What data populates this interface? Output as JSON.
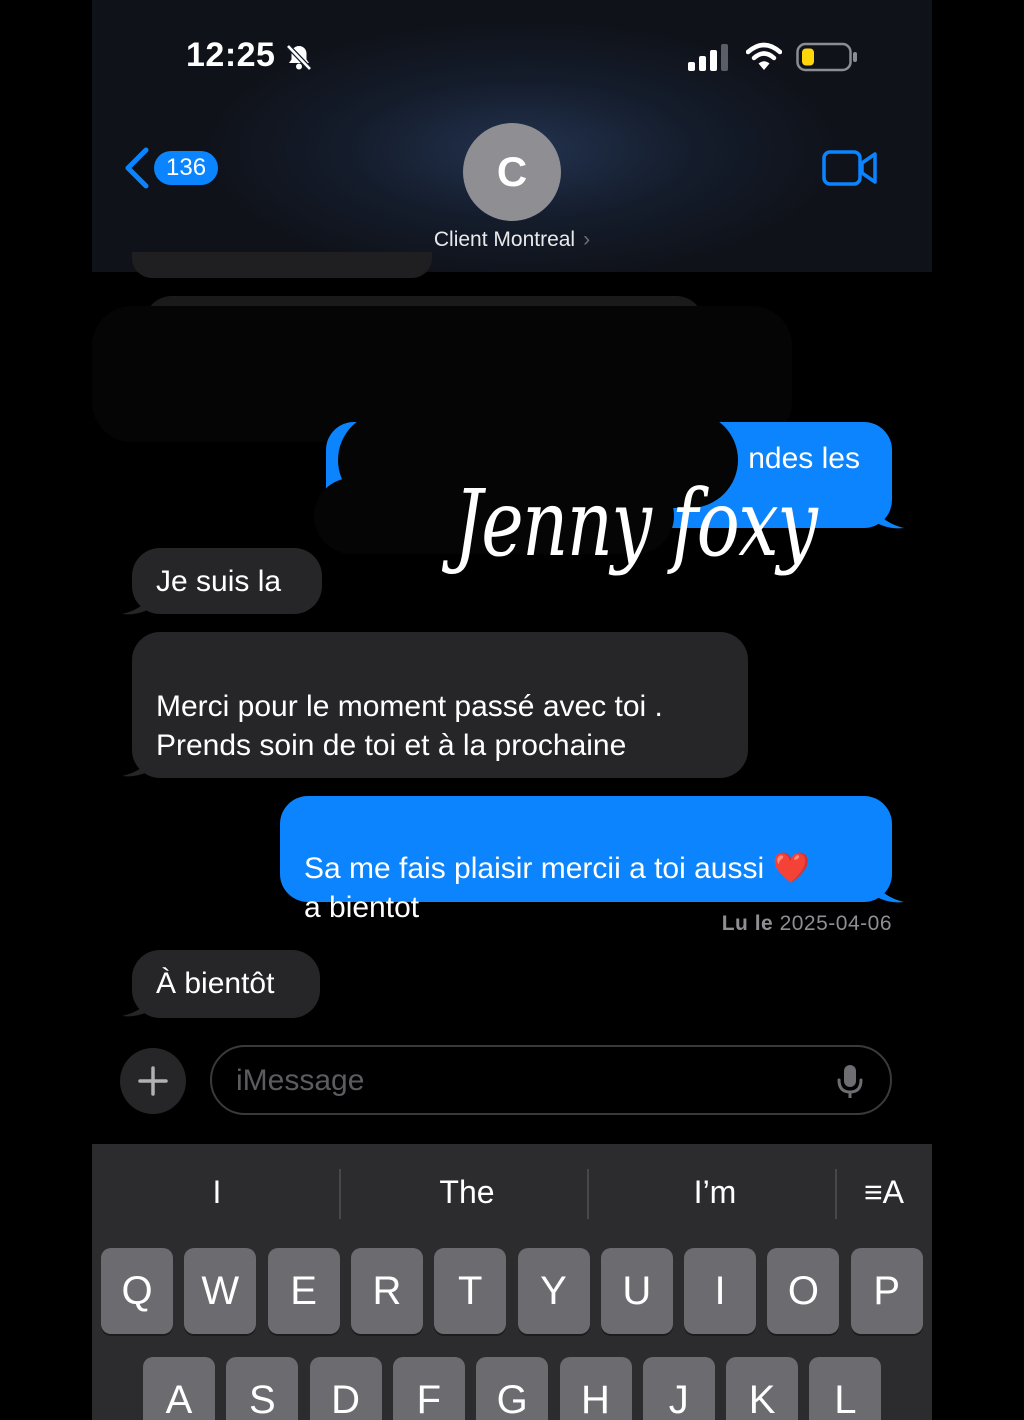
{
  "status_bar": {
    "time": "12:25",
    "icons": [
      "bell-slash-icon",
      "signal-icon",
      "wifi-icon",
      "battery-low-icon"
    ]
  },
  "nav": {
    "back_count": "136",
    "avatar_initial": "C",
    "contact_name": "Client Montreal",
    "chevron": "›",
    "video_icon": "video-camera-icon"
  },
  "messages": [
    {
      "side": "out",
      "text": "ndes les",
      "partially_redacted": true
    },
    {
      "side": "in",
      "text": "Je suis la"
    },
    {
      "side": "in",
      "text": "Merci pour le moment passé avec toi .\nPrends soin de toi et à la prochaine"
    },
    {
      "side": "out",
      "text": "Sa me fais plaisir mercii a toi aussi ❤️\na bientot"
    },
    {
      "side": "in",
      "text": "À bientôt"
    }
  ],
  "read_receipt": {
    "label": "Lu le",
    "date": "2025-04-06"
  },
  "watermark": "Jenny foxy",
  "composer": {
    "placeholder": "iMessage",
    "plus_label": "+"
  },
  "keyboard": {
    "suggestions": [
      "I",
      "The",
      "I’m"
    ],
    "format_icon": "≡A",
    "row1": [
      "Q",
      "W",
      "E",
      "R",
      "T",
      "Y",
      "U",
      "I",
      "O",
      "P"
    ],
    "row2": [
      "A",
      "S",
      "D",
      "F",
      "G",
      "H",
      "J",
      "K",
      "L"
    ]
  },
  "colors": {
    "accent": "#0a84ff",
    "incoming_bubble": "#262628",
    "outgoing_bubble": "#0b84fe",
    "background": "#000000"
  }
}
